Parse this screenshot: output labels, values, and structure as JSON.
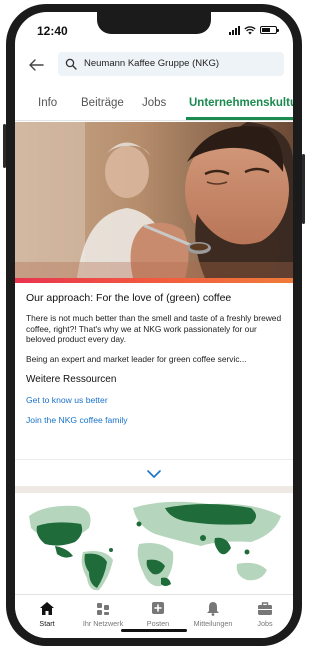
{
  "status_bar": {
    "time": "12:40"
  },
  "search": {
    "query": "Neumann Kaffee Gruppe (NKG)"
  },
  "tabs": [
    {
      "label": "Info",
      "active": false
    },
    {
      "label": "Beiträge",
      "active": false
    },
    {
      "label": "Jobs",
      "active": false
    },
    {
      "label": "Unternehmenskultur",
      "active": true
    }
  ],
  "content": {
    "title": "Our approach: For the love of (green) coffee",
    "paragraph1": "There is not much better than the smell and taste of a freshly brewed coffee, right?! That's why we at NKG work passionately for our beloved product every day.",
    "paragraph2": "Being an expert and market leader for green coffee servic...",
    "resources_title": "Weitere Ressourcen",
    "links": [
      "Get to know us better",
      "Join the NKG coffee family"
    ]
  },
  "bottom_nav": [
    {
      "label": "Start",
      "icon": "home-icon",
      "active": true
    },
    {
      "label": "Ihr Netzwerk",
      "icon": "network-icon",
      "active": false
    },
    {
      "label": "Posten",
      "icon": "post-icon",
      "active": false
    },
    {
      "label": "Mitteilungen",
      "icon": "bell-icon",
      "active": false
    },
    {
      "label": "Jobs",
      "icon": "briefcase-icon",
      "active": false
    }
  ],
  "colors": {
    "accent_green": "#1b8a4e",
    "link_blue": "#1a73c9",
    "map_green": "#1f6b3a"
  }
}
